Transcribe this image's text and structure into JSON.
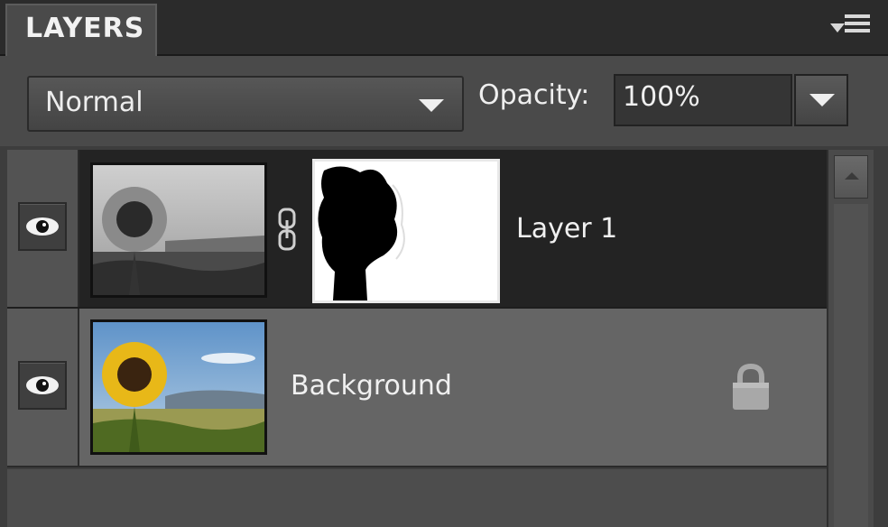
{
  "panel": {
    "tab_title": "LAYERS"
  },
  "options": {
    "blend_mode": "Normal",
    "opacity_label": "Opacity:",
    "opacity_value": "100%"
  },
  "layers": [
    {
      "name": "Layer 1",
      "visible": true,
      "selected": true,
      "has_mask": true
    },
    {
      "name": "Background",
      "visible": true,
      "selected": false,
      "locked": true
    }
  ],
  "icons": {
    "panel_menu": "panel-menu-icon",
    "visibility": "eye-icon",
    "mask_link": "chain-link-icon",
    "lock": "lock-icon"
  }
}
